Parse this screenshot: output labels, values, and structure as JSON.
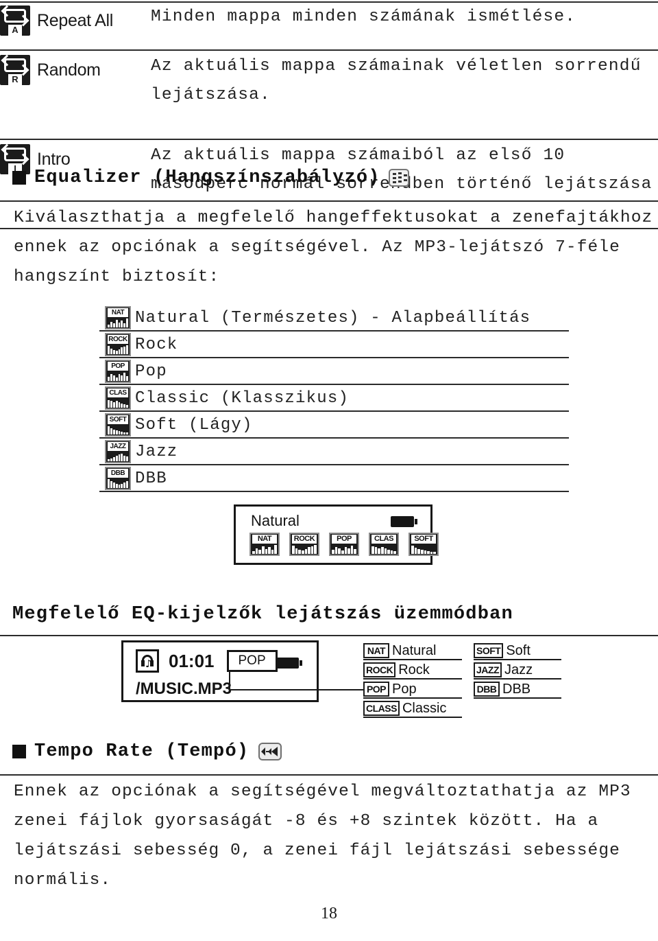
{
  "document": {
    "page_number": "18",
    "language": "hu"
  },
  "mode_table": {
    "rows": [
      {
        "icon_name": "repeat-all-icon",
        "icon_letter": "A",
        "label": "Repeat All",
        "description_lines": [
          "Minden mappa minden számának ismétlése."
        ]
      },
      {
        "icon_name": "random-icon",
        "icon_letter": "R",
        "label": "Random",
        "description_lines": [
          "Az aktuális mappa számainak véletlen sorrendű",
          "lejátszása."
        ]
      },
      {
        "icon_name": "intro-icon",
        "icon_letter": "I",
        "label": "Intro",
        "description_lines": [
          "Az aktuális mappa számaiból az első 10",
          "másodperc normál sorrendben történő lejátszása"
        ]
      }
    ]
  },
  "equalizer_section": {
    "bullet": "■",
    "title": "Equalizer (Hangszínszabályzó)",
    "icon_name": "equalizer-icon",
    "paragraph_lines": [
      "Kiválaszthatja a megfelelő hangeffektusokat a zenefajtákhoz",
      "ennek az opciónak a segítségével. Az MP3-lejátszó 7-féle",
      "hangszínt biztosít:"
    ],
    "presets": [
      {
        "tag": "NAT",
        "name": "Natural (Természetes) - Alapbeállítás",
        "bars": [
          30,
          55,
          40,
          80,
          50,
          70,
          45,
          90
        ]
      },
      {
        "tag": "ROCK",
        "name": "Rock",
        "bars": [
          85,
          60,
          45,
          35,
          50,
          70,
          80,
          90
        ]
      },
      {
        "tag": "POP",
        "name": "Pop",
        "bars": [
          40,
          70,
          55,
          35,
          75,
          60,
          85,
          50
        ]
      },
      {
        "tag": "CLAS",
        "name": "Classic (Klasszikus)",
        "bars": [
          80,
          70,
          60,
          75,
          55,
          45,
          35,
          30
        ]
      },
      {
        "tag": "SOFT",
        "name": "Soft (Lágy)",
        "bars": [
          85,
          65,
          50,
          40,
          35,
          30,
          25,
          20
        ]
      },
      {
        "tag": "JAZZ",
        "name": "Jazz",
        "bars": [
          20,
          30,
          45,
          55,
          70,
          80,
          60,
          50
        ]
      },
      {
        "tag": "DBB",
        "name": "DBB",
        "bars": [
          90,
          75,
          55,
          40,
          35,
          45,
          60,
          70
        ]
      }
    ]
  },
  "natural_display": {
    "screen_label": "Natural",
    "battery_name": "battery-icon",
    "presets": [
      {
        "tag": "NAT",
        "bars": [
          30,
          55,
          40,
          80,
          50,
          70,
          45,
          90
        ]
      },
      {
        "tag": "ROCK",
        "bars": [
          85,
          60,
          45,
          35,
          50,
          70,
          80,
          90
        ]
      },
      {
        "tag": "POP",
        "bars": [
          40,
          70,
          55,
          35,
          75,
          60,
          85,
          50
        ]
      },
      {
        "tag": "CLAS",
        "bars": [
          80,
          70,
          60,
          75,
          55,
          45,
          35,
          30
        ]
      },
      {
        "tag": "SOFT",
        "bars": [
          85,
          65,
          50,
          40,
          35,
          30,
          25,
          20
        ]
      }
    ]
  },
  "eq_indicator_section": {
    "heading": "Megfelelő EQ-kijelzők lejátszás üzemmódban",
    "player": {
      "headphone_icon_name": "headphone-music-icon",
      "time": "01:01",
      "eq_badge": "POP",
      "battery_icon_name": "battery-icon",
      "file_name": "/MUSIC.MP3"
    },
    "legend_left": [
      {
        "tag": "NAT",
        "label": "Natural"
      },
      {
        "tag": "ROCK",
        "label": "Rock"
      },
      {
        "tag": "POP",
        "label": "Pop"
      },
      {
        "tag": "CLASS",
        "label": "Classic"
      }
    ],
    "legend_right": [
      {
        "tag": "SOFT",
        "label": "Soft"
      },
      {
        "tag": "JAZZ",
        "label": "Jazz"
      },
      {
        "tag": "DBB",
        "label": "DBB"
      }
    ]
  },
  "tempo_section": {
    "bullet": "■",
    "title": "Tempo Rate (Tempó)",
    "icon_name": "tempo-rate-icon",
    "paragraph_lines": [
      "Ennek az opciónak a segítségével megváltoztathatja az MP3",
      "zenei fájlok gyorsaságát -8 és +8 szintek között. Ha a",
      "lejátszási sebesség 0, a zenei fájl lejátszási sebessége",
      "normális."
    ]
  }
}
